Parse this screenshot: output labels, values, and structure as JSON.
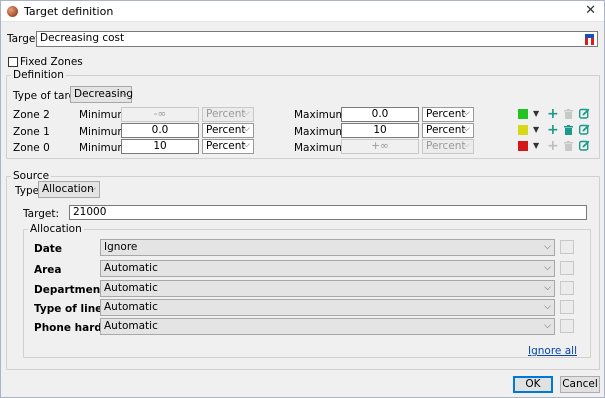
{
  "window": {
    "title": "Target definition"
  },
  "target": {
    "label": "Target:",
    "value": "Decreasing cost"
  },
  "fixed_zones": {
    "label": "Fixed Zones",
    "checked": false
  },
  "definition": {
    "group_title": "Definition",
    "type_label": "Type of target:",
    "type_value": "Decreasing",
    "zones": [
      {
        "name": "Zone 2",
        "min_label": "Minimum:",
        "min_value": "-∞",
        "min_unit": "Percent",
        "min_disabled": true,
        "max_label": "Maximum:",
        "max_value": "0.0",
        "max_unit": "Percent",
        "max_disabled": false,
        "color": "#22c422",
        "color_name": "green",
        "delete_enabled": false
      },
      {
        "name": "Zone 1",
        "min_label": "Minimum:",
        "min_value": "0.0",
        "min_unit": "Percent",
        "min_disabled": false,
        "max_label": "Maximum:",
        "max_value": "10",
        "max_unit": "Percent",
        "max_disabled": false,
        "color": "#d8d818",
        "color_name": "yellow",
        "delete_enabled": true
      },
      {
        "name": "Zone 0",
        "min_label": "Minimum:",
        "min_value": "10",
        "min_unit": "Percent",
        "min_disabled": false,
        "max_label": "Maximum:",
        "max_value": "+∞",
        "max_unit": "Percent",
        "max_disabled": true,
        "color": "#d41818",
        "color_name": "red",
        "delete_enabled": false
      }
    ]
  },
  "source": {
    "group_title": "Source",
    "type_label": "Type:",
    "type_value": "Allocation",
    "target_label": "Target:",
    "target_value": "21000",
    "allocation": {
      "group_title": "Allocation",
      "rows": [
        {
          "label": "Date",
          "value": "Ignore"
        },
        {
          "label": "Area",
          "value": "Automatic"
        },
        {
          "label": "Department",
          "value": "Automatic"
        },
        {
          "label": "Type of line",
          "value": "Automatic"
        },
        {
          "label": "Phone hardware",
          "value": "Automatic"
        }
      ],
      "ignore_all_label": "Ignore all"
    }
  },
  "buttons": {
    "ok": "OK",
    "cancel": "Cancel"
  },
  "colors": {
    "accent_teal": "#1a9a8a",
    "link": "#0645ad",
    "focus": "#0078d7"
  }
}
